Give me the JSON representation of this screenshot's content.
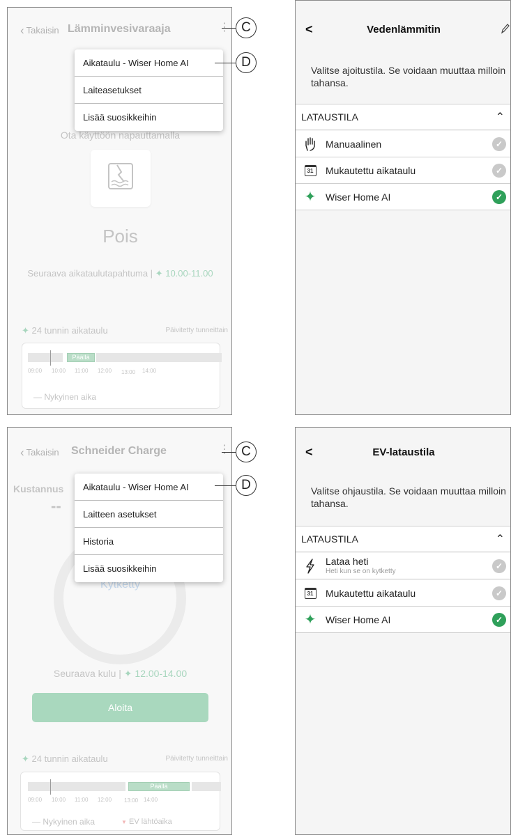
{
  "panel1": {
    "back_label": "Takaisin",
    "title": "Lämminvesivaraaja",
    "callout_c": "C",
    "callout_d": "D",
    "menu": [
      "Aikataulu - Wiser Home AI",
      "Laiteasetukset",
      "Lisää suosikkeihin"
    ],
    "hint": "Ota käyttöön napauttamalla",
    "state": "Pois",
    "next_event_label": "Seuraava aikataulutapahtuma |",
    "next_event_time": "10.00-11.00",
    "schedule_title": "24 tunnin aikataulu",
    "schedule_updated": "Päivitetty tunneittain",
    "on_label": "Päällä",
    "ticks": [
      "09:00",
      "10:00",
      "11:00",
      "12:00",
      "13:00",
      "14:00"
    ],
    "legend_now": "— Nykyinen aika"
  },
  "panel2": {
    "back_icon": "<",
    "title": "Vedenlämmitin",
    "edit_icon": "pencil-icon",
    "description": "Valitse ajoitustila. Se voidaan muuttaa milloin tahansa.",
    "section": "LATAUSTILA",
    "options": [
      {
        "label": "Manuaalinen",
        "icon": "hand-icon",
        "selected": false
      },
      {
        "label": "Mukautettu aikataulu",
        "icon": "calendar-icon",
        "icon_text": "31",
        "selected": false
      },
      {
        "label": "Wiser Home AI",
        "icon": "sparkle-icon",
        "selected": true
      }
    ]
  },
  "panel3": {
    "back_label": "Takaisin",
    "title": "Schneider Charge",
    "callout_c": "C",
    "callout_d": "D",
    "menu": [
      "Aikataulu - Wiser Home AI",
      "Laitteen asetukset",
      "Historia",
      "Lisää suosikkeihin"
    ],
    "cost_label": "Kustannus",
    "cost_value": "--",
    "ring_label": "Kytketty",
    "next_cost_label": "Seuraava kulu |",
    "next_cost_time": "12.00-14.00",
    "start_button": "Aloita",
    "schedule_title": "24 tunnin aikataulu",
    "schedule_updated": "Päivitetty tunneittain",
    "on_label": "Päällä",
    "ticks": [
      "09:00",
      "10:00",
      "11:00",
      "12:00",
      "13:00",
      "14:00"
    ],
    "legend_now": "— Nykyinen aika",
    "legend_ev": "EV lähtöaika"
  },
  "panel4": {
    "back_icon": "<",
    "title": "EV-lataustila",
    "description": "Valitse ohjaustila. Se voidaan muuttaa milloin tahansa.",
    "section": "LATAUSTILA",
    "options": [
      {
        "label": "Lataa heti",
        "sublabel": "Heti kun se on kytketty",
        "icon": "lightning-icon",
        "selected": false
      },
      {
        "label": "Mukautettu aikataulu",
        "icon": "calendar-icon",
        "icon_text": "31",
        "selected": false
      },
      {
        "label": "Wiser Home AI",
        "icon": "sparkle-icon",
        "selected": true
      }
    ]
  },
  "colors": {
    "selected_check": "#2fa05a",
    "unselected_check": "#c9c9c9",
    "ai_green_faded": "#a8d6be",
    "start_button": "#a9d8be"
  }
}
